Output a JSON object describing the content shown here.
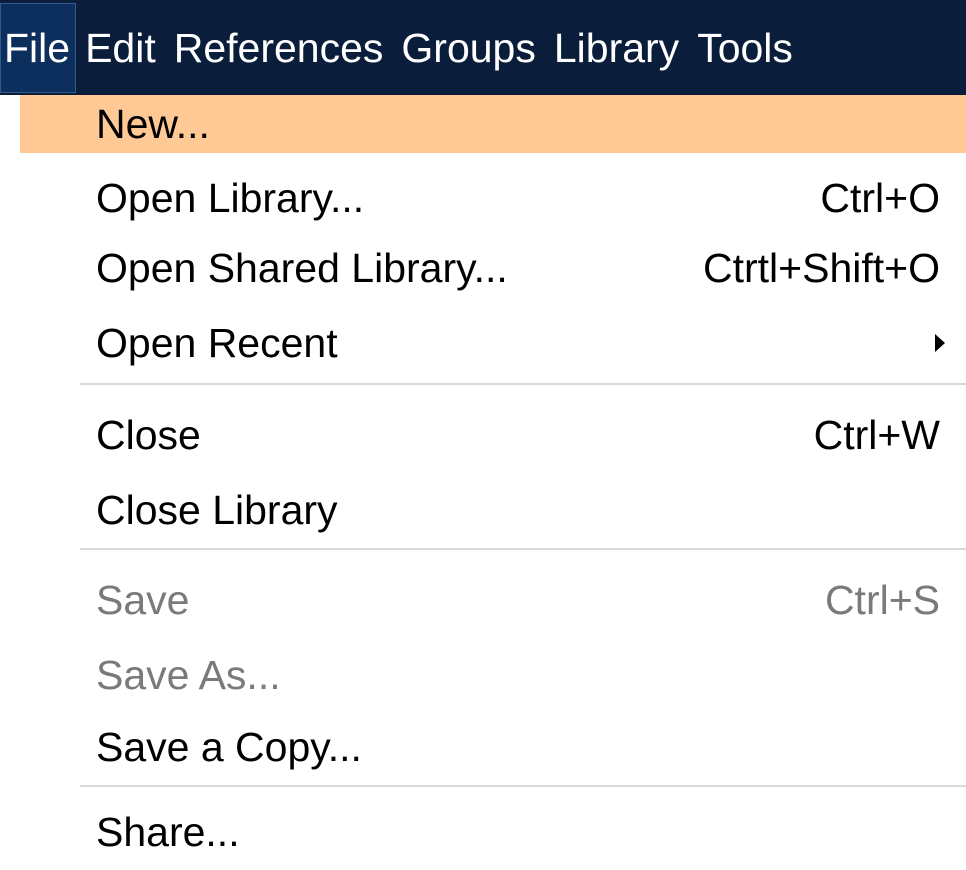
{
  "menubar": {
    "items": [
      {
        "label": "File"
      },
      {
        "label": "Edit"
      },
      {
        "label": "References"
      },
      {
        "label": "Groups"
      },
      {
        "label": "Library"
      },
      {
        "label": "Tools"
      }
    ],
    "active_item": "File"
  },
  "file_menu": {
    "items": [
      {
        "label": "New...",
        "shortcut": "",
        "state": "highlighted"
      },
      {
        "label": "Open Library...",
        "shortcut": "Ctrl+O"
      },
      {
        "label": "Open Shared Library...",
        "shortcut": "Ctrtl+Shift+O"
      },
      {
        "label": "Open Recent",
        "submenu_icon": "submenu-arrow-icon"
      },
      {
        "label": "Close",
        "shortcut": "Ctrl+W"
      },
      {
        "label": "Close Library",
        "shortcut": ""
      },
      {
        "label": "Save",
        "shortcut": "Ctrl+S",
        "state": "disabled"
      },
      {
        "label": "Save As...",
        "shortcut": "",
        "state": "disabled"
      },
      {
        "label": "Save a Copy...",
        "shortcut": ""
      },
      {
        "label": "Share...",
        "shortcut": ""
      }
    ]
  },
  "colors": {
    "menubar_bg": "#0a1e3c",
    "highlight": "#fec995",
    "disabled_text": "#7a7a7a",
    "separator": "#d9d9d9"
  }
}
